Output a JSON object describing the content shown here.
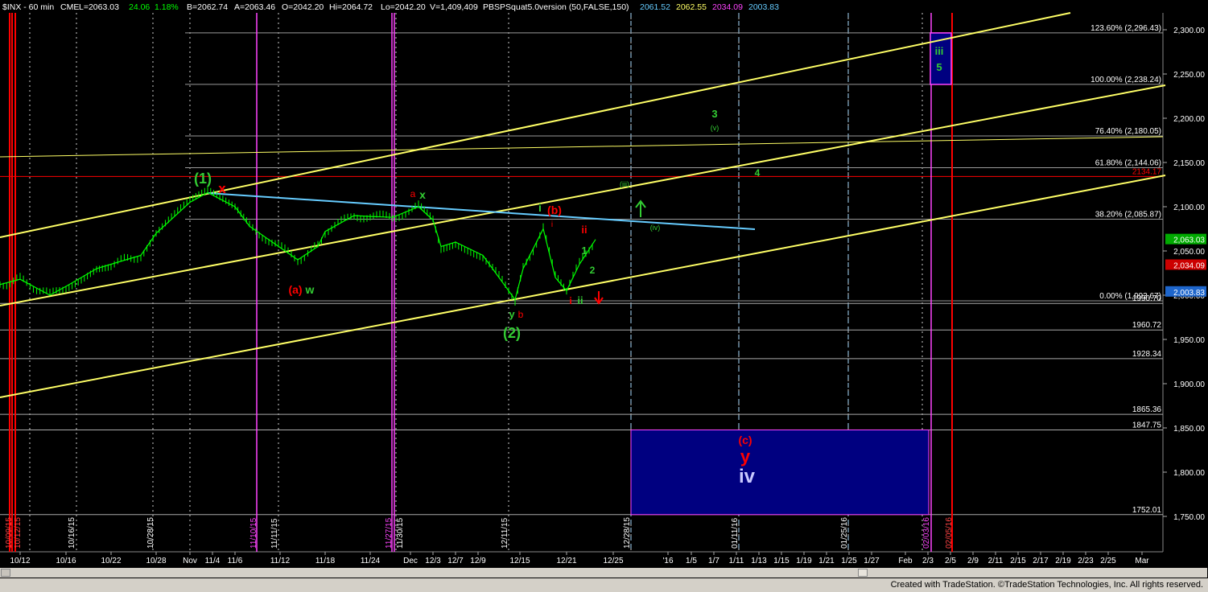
{
  "header": {
    "symbol": "$INX - 60 min",
    "exchange": "CME",
    "last": "L=2063.03",
    "change": "24.06",
    "change_pct": "1.18%",
    "bid": "B=2062.74",
    "ask": "A=2063.46",
    "open": "O=2042.20",
    "high": "Hi=2064.72",
    "low": "Lo=2042.20",
    "volume": "V=1,409,409",
    "indicator": "PBSPSquat5.0version (50,FALSE,150)",
    "ind_v1": "2061.52",
    "ind_v2": "2062.55",
    "ind_v3": "2034.09",
    "ind_v4": "2003.83"
  },
  "footer": {
    "credit": "Created with TradeStation. ©TradeStation Technologies, Inc. All rights reserved."
  },
  "colors": {
    "background": "#000000",
    "price": "#00ff00",
    "channel": "#ffff66",
    "trendline": "#66ccff",
    "fib": "#ffffff",
    "red": "#ff0000",
    "magenta": "#ff44ff",
    "green": "#33cc33",
    "target_box": "#000080"
  },
  "chart_data": {
    "type": "line",
    "ylim": [
      1700,
      2320
    ],
    "y_ticks": [
      "2,300.00",
      "2,250.00",
      "2,200.00",
      "2,150.00",
      "2,100.00",
      "2,050.00",
      "2,000.00",
      "1,950.00",
      "1,900.00",
      "1,850.00",
      "1,800.00",
      "1,750.00"
    ],
    "y_tick_values": [
      2300,
      2250,
      2200,
      2150,
      2100,
      2050,
      2000,
      1950,
      1900,
      1850,
      1800,
      1750
    ],
    "x_ticks": [
      "10/12",
      "10/16",
      "10/22",
      "10/28",
      "Nov",
      "11/4",
      "11/6",
      "11/12",
      "11/18",
      "11/24",
      "Dec",
      "12/3",
      "12/7",
      "12/9",
      "12/15",
      "12/21",
      "12/25",
      "'16",
      "1/5",
      "1/7",
      "1/11",
      "1/13",
      "1/15",
      "1/19",
      "1/21",
      "1/25",
      "1/27",
      "Feb",
      "2/3",
      "2/5",
      "2/9",
      "2/11",
      "2/15",
      "2/17",
      "2/19",
      "2/23",
      "2/25",
      "Mar"
    ],
    "date_labels": [
      "10/09/15",
      "10/12/15",
      "10/16/15",
      "10/28/15",
      "11/10/15",
      "11/11/15",
      "11/27/15",
      "11/30/15",
      "12/11/15",
      "12/28/15",
      "01/11/16",
      "01/25/16",
      "02/03/16",
      "02/05/16"
    ],
    "price_series": {
      "name": "",
      "x": [
        "10/9",
        "10/12",
        "10/14",
        "10/16",
        "10/20",
        "10/22",
        "10/26",
        "10/28",
        "11/2",
        "11/4",
        "11/6",
        "11/9",
        "11/12",
        "11/16",
        "11/18",
        "11/20",
        "11/24",
        "11/27",
        "12/1",
        "12/3",
        "12/4",
        "12/7",
        "12/9",
        "12/11",
        "12/14",
        "12/15",
        "12/17",
        "12/18",
        "12/21",
        "12/22",
        "12/23"
      ],
      "values": [
        2012,
        2018,
        2000,
        2010,
        2030,
        2035,
        2045,
        2070,
        2105,
        2116,
        2100,
        2078,
        2040,
        2055,
        2072,
        2090,
        2089,
        2088,
        2100,
        2085,
        2055,
        2060,
        2045,
        2020,
        1995,
        2030,
        2075,
        2020,
        2005,
        2035,
        2063
      ]
    },
    "fib_levels": [
      {
        "label": "123.60% (2,296.43)",
        "value": 2296.43
      },
      {
        "label": "100.00% (2,238.24)",
        "value": 2238.24
      },
      {
        "label": "76.40% (2,180.05)",
        "value": 2180.05
      },
      {
        "label": "61.80% (2,144.06)",
        "value": 2144.06
      },
      {
        "label": "38.20% (2,085.87)",
        "value": 2085.87
      },
      {
        "label": "0.00% (1,993.67)",
        "value": 1993.67
      }
    ],
    "levels": [
      {
        "label": "2134.17",
        "value": 2134.17
      },
      {
        "label": "1990.70",
        "value": 1990.7
      },
      {
        "label": "1960.72",
        "value": 1960.72
      },
      {
        "label": "1928.34",
        "value": 1928.34
      },
      {
        "label": "1865.36",
        "value": 1865.36
      },
      {
        "label": "1847.75",
        "value": 1847.75
      },
      {
        "label": "1752.01",
        "value": 1752.01
      }
    ],
    "price_tags": [
      {
        "label": "2,063.03",
        "value": 2063.03
      },
      {
        "label": "2,034.09",
        "value": 2034.09
      },
      {
        "label": "2,003.83",
        "value": 2003.83
      }
    ],
    "target_box": {
      "top": 1847.75,
      "bottom": 1752.01
    },
    "upper_box": {
      "top": 2296.43,
      "bottom": 2238.24
    },
    "wave_labels": [
      "(1)",
      "x",
      "(a)",
      "w",
      "a",
      "x",
      "(b)",
      "i",
      "i",
      "ii",
      "1",
      "2",
      "i",
      "ii",
      "y",
      "b",
      "(2)",
      "(iii)",
      "(iv)",
      "3",
      "(v)",
      "4",
      "iii",
      "5",
      "(c)",
      "y",
      "iv"
    ]
  }
}
